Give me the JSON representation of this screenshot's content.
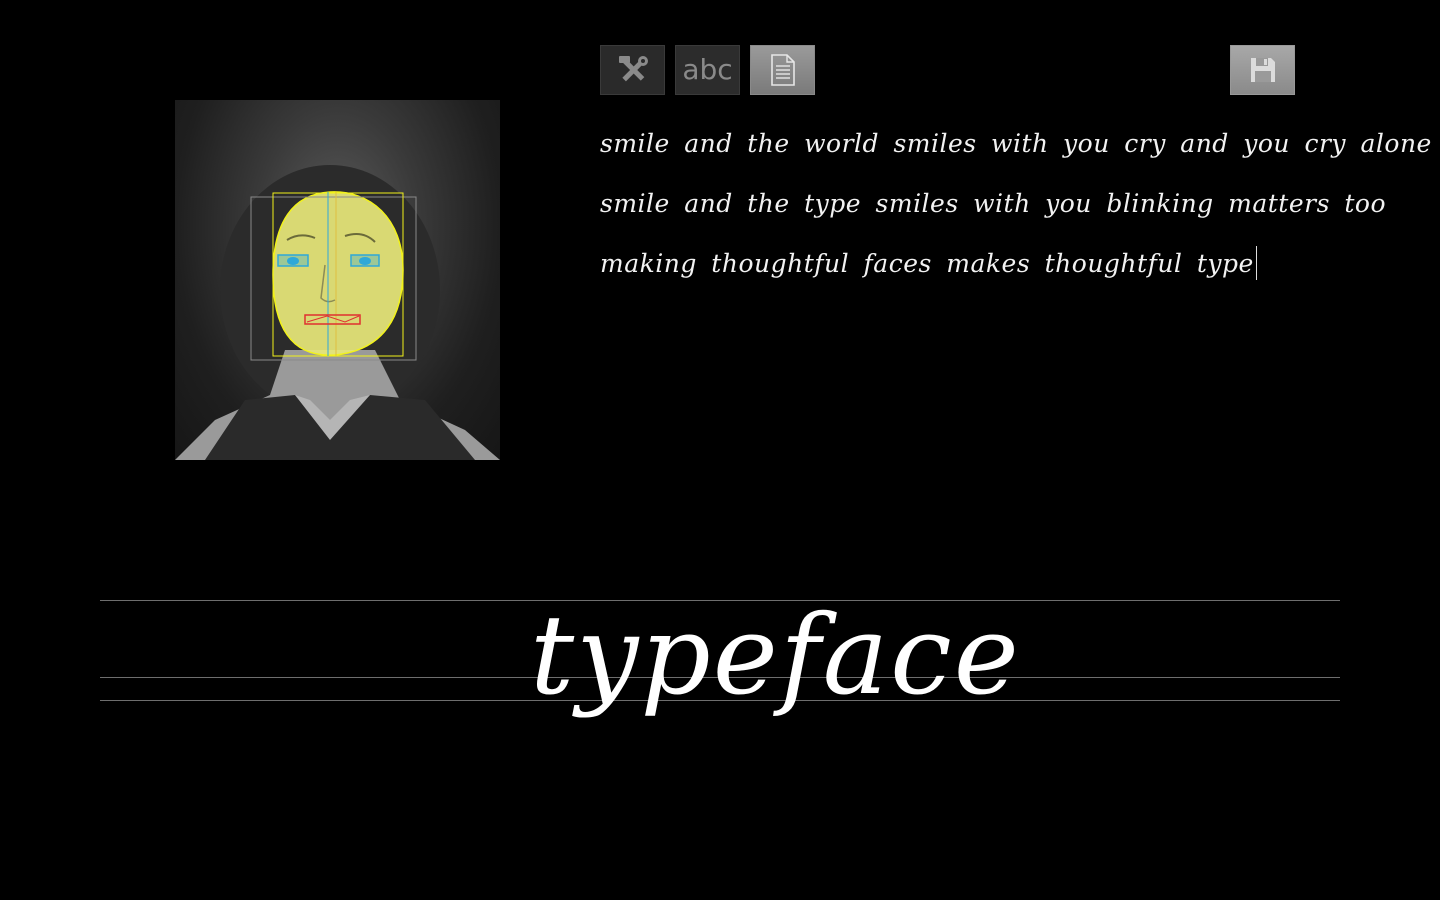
{
  "toolbar": {
    "tools_icon": "tools-icon",
    "abc_label": "abc",
    "document_icon": "document-icon",
    "save_icon": "save-icon"
  },
  "face_view": {
    "overlay_colors": {
      "face_mask": "#e8e87a",
      "face_outline": "#f2f21a",
      "eyes": "#2fa8d8",
      "mouth": "#e03030",
      "center_line": "#2fa8d8",
      "outer_box": "#8a8a8a"
    }
  },
  "text": {
    "lines": [
      "smile and the world smiles with you cry and you cry alone",
      "smile and the type smiles with you blinking matters too",
      "making thoughtful faces makes thoughtful type"
    ]
  },
  "preview": {
    "word": "typeface"
  }
}
